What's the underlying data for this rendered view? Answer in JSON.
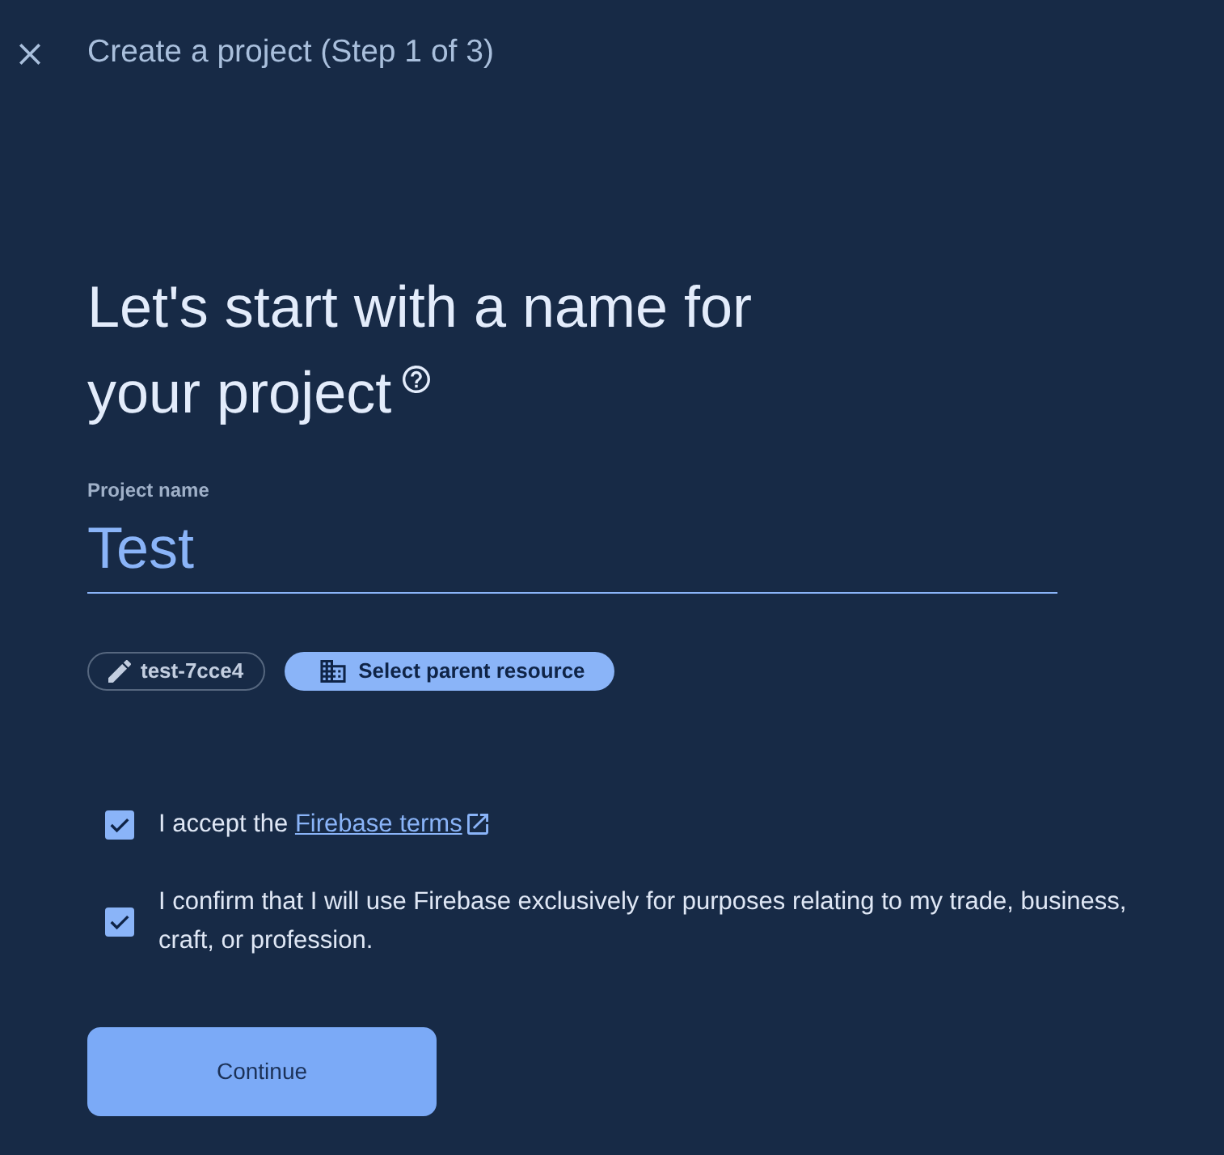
{
  "header": {
    "title": "Create a project (Step 1 of 3)"
  },
  "heading": {
    "lines": [
      "Let's start with a name for",
      "your project"
    ]
  },
  "project_name_field": {
    "label": "Project name",
    "value": "Test"
  },
  "chips": [
    {
      "kind": "edit",
      "label": "test-7cce4"
    },
    {
      "kind": "select",
      "label": "Select parent resource"
    }
  ],
  "agreements": [
    {
      "text": "I accept the ",
      "link": "Firebase terms",
      "checked": true
    },
    {
      "text": "I confirm that I will use Firebase exclusively for purposes relating to my trade, business, craft, or profession.",
      "checked": true
    }
  ],
  "continue_button": {
    "label": "Continue"
  }
}
